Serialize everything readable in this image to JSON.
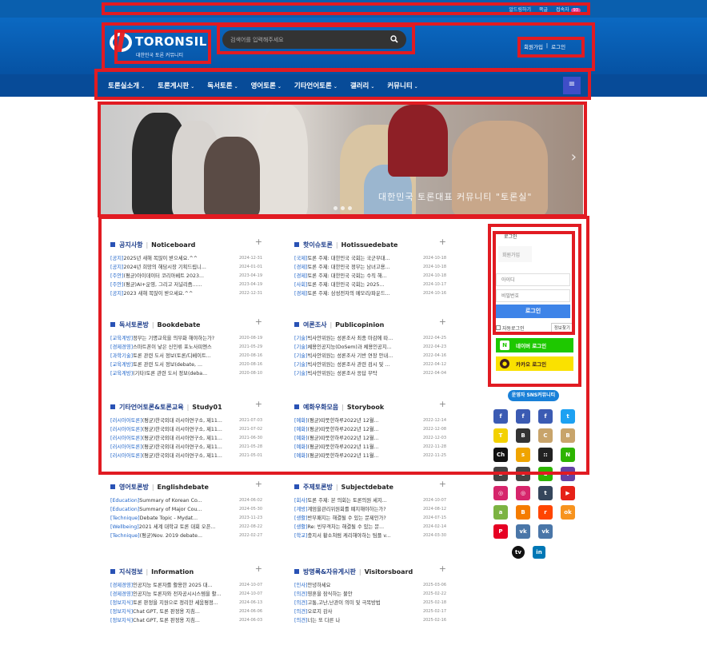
{
  "topbar": {
    "links": [
      "알드링하기",
      "쪽글",
      "접속자"
    ],
    "badge": "93"
  },
  "header": {
    "logo_name": "TORONSIL",
    "logo_sub": "대한민국 토론 커뮤니티",
    "search_placeholder": "검색어를 입력해주세요",
    "join": "회원가입",
    "sep": "|",
    "login": "로그인"
  },
  "nav": {
    "items": [
      "토론실소개",
      "토론게시판",
      "독서토론",
      "영어토론",
      "기타언어토론",
      "갤러리",
      "커뮤니티"
    ],
    "menu_icon": "hamburger-icon"
  },
  "banner": {
    "caption": "대한민국 토론대표 커뮤니티 \"토론실\""
  },
  "boards": [
    {
      "ko": "공지사항",
      "en": "Noticeboard",
      "rows": [
        {
          "cat": "[공지]",
          "t": "2025년 새해 복많이 받으세요.^^",
          "d": "2024-12-31"
        },
        {
          "cat": "[공지]",
          "t": "2024년 희망의 해담시장 기획드립니...",
          "d": "2024-01-01"
        },
        {
          "cat": "[주안]",
          "t": "(평균)아이데이터 코리아베트 2023...",
          "d": "2023-04-19"
        },
        {
          "cat": "[주안]",
          "t": "(평균)AI+운영, 그리고 저널리즘......",
          "d": "2023-04-19"
        },
        {
          "cat": "[공지]",
          "t": "2023 새해 복많이 받으세요.^^",
          "d": "2022-12-31"
        }
      ]
    },
    {
      "ko": "핫이슈토론",
      "en": "Hotissuedebate",
      "rows": [
        {
          "cat": "[국제]",
          "t": "토론 주제: 대한민국 국회는 국군부대...",
          "d": "2024-10-18"
        },
        {
          "cat": "[경제]",
          "t": "토론 주제: 대한민국 정부는 남녀고용...",
          "d": "2024-10-18"
        },
        {
          "cat": "[경제]",
          "t": "토론 주제: 대한민국 국회는 수직 해...",
          "d": "2024-10-18"
        },
        {
          "cat": "[사회]",
          "t": "토론 주제: 대한민국 국회는 2025...",
          "d": "2024-10-17"
        },
        {
          "cat": "[경제]",
          "t": "토론 주제: 삼성전자의 메모리/파운드...",
          "d": "2024-10-16"
        }
      ]
    },
    {
      "ko": "독서토론방",
      "en": "Bookdebate",
      "rows": [
        {
          "cat": "[교육계방]",
          "t": "정부는 기명교육을 의무화 해야하는가?",
          "d": "2020-08-19"
        },
        {
          "cat": "[경제경영]",
          "t": "스마트폰이 낳은 신인류 포노사피엔스",
          "d": "2021-05-29"
        },
        {
          "cat": "[과학기술]",
          "t": "토론 관련 도서 정보(토론/디베이트...",
          "d": "2020-08-16"
        },
        {
          "cat": "[교육계방]",
          "t": "토론 관련 도서 정보(debate, ...",
          "d": "2020-08-16"
        },
        {
          "cat": "[교육계방]",
          "t": "(기타)토론 관련 도서 정보(deba...",
          "d": "2020-08-10"
        }
      ]
    },
    {
      "ko": "여론조사",
      "en": "Publicopinion",
      "rows": [
        {
          "cat": "[기술]",
          "t": "빅사안위원는 성론조사 최종 마감에 따...",
          "d": "2022-04-25"
        },
        {
          "cat": "[기술]",
          "t": "체용인공지능(DoSem)과 체용인공지...",
          "d": "2022-04-23"
        },
        {
          "cat": "[기술]",
          "t": "빅사안위원는 성론조사 기반 연장 안내...",
          "d": "2022-04-16"
        },
        {
          "cat": "[기술]",
          "t": "빅사안위원는 성론조사 관련 검시 및 ...",
          "d": "2022-04-12"
        },
        {
          "cat": "[기술]",
          "t": "빅사안위원는 성론조사 응답 부탁",
          "d": "2022-04-04"
        }
      ]
    },
    {
      "ko": "기타언어토론&토론교육",
      "en": "Study01",
      "rows": [
        {
          "cat": "[러시아어토론]",
          "t": "(평균)한국외대 러시아연구소, 제11...",
          "d": "2021-07-03"
        },
        {
          "cat": "[러시아어토론]",
          "t": "(평균)한국외대 러시아연구소, 제11...",
          "d": "2021-07-02"
        },
        {
          "cat": "[러시아어토론]",
          "t": "(평균)한국외대 러시아연구소, 제11...",
          "d": "2021-06-30"
        },
        {
          "cat": "[러시아어토론]",
          "t": "(평균)한국외대 러시아연구소, 제11...",
          "d": "2021-05-28"
        },
        {
          "cat": "[러시아어토론]",
          "t": "(평균)한국외대 러시아연구소, 제11...",
          "d": "2021-05-01"
        }
      ]
    },
    {
      "ko": "예화우화모음",
      "en": "Storybook",
      "rows": [
        {
          "cat": "[예화]",
          "t": "(평균)따뜻한하루2022년 12월...",
          "d": "2022-12-14"
        },
        {
          "cat": "[예화]",
          "t": "(평균)따뜻한하루2022년 12월...",
          "d": "2022-12-08"
        },
        {
          "cat": "[예화]",
          "t": "(평균)따뜻한하루2022년 12월...",
          "d": "2022-12-03"
        },
        {
          "cat": "[예화]",
          "t": "(평균)따뜻한하루2022년 11월...",
          "d": "2022-11-28"
        },
        {
          "cat": "[예화]",
          "t": "(평균)따뜻한하루2022년 11월...",
          "d": "2022-11-25"
        }
      ]
    },
    {
      "ko": "영어토론방",
      "en": "Englishdebate",
      "rows": [
        {
          "cat": "[Education]",
          "t": "Summary of Korean Co...",
          "d": "2024-06-02"
        },
        {
          "cat": "[Education]",
          "t": "Summary of Major Cou...",
          "d": "2024-05-30"
        },
        {
          "cat": "[Technique]",
          "t": "Debate Topic - Mydat...",
          "d": "2023-11-23"
        },
        {
          "cat": "[Wellbeing]",
          "t": "2021 세계 대학교 토론 대회 오픈...",
          "d": "2022-08-22"
        },
        {
          "cat": "[Technique]",
          "t": "(평균)Nov. 2019 debate...",
          "d": "2022-02-27"
        }
      ]
    },
    {
      "ko": "주제토론방",
      "en": "Subjectdebate",
      "rows": [
        {
          "cat": "[회사]",
          "t": "토론 주제: 본 의회는 토론의원 세지...",
          "d": "2024-10-07"
        },
        {
          "cat": "[계방]",
          "t": "계엄을관리위원회를 폐지해야하는가?",
          "d": "2024-08-12"
        },
        {
          "cat": "[생활]",
          "t": "반부패지는 해결될 수 있는 문제인가?",
          "d": "2024-07-15"
        },
        {
          "cat": "[생활]",
          "t": "Re: 빈부격차는 해결될 수 있는 문...",
          "d": "2024-02-14"
        },
        {
          "cat": "[학교]",
          "t": "충지서 황소쳐럼 케리해야하는 팀플 v...",
          "d": "2024-03-30"
        }
      ]
    },
    {
      "ko": "지식정보",
      "en": "Information",
      "rows": [
        {
          "cat": "[경제경영]",
          "t": "인공지능 토론자를 활용한 2025 대...",
          "d": "2024-10-07"
        },
        {
          "cat": "[경제경영]",
          "t": "인공지능 토론자와 전자공시시스템을 활...",
          "d": "2024-10-07"
        },
        {
          "cat": "[정보지식]",
          "t": "토론 판정을 지원으로 정리한 세움평정...",
          "d": "2024-06-13"
        },
        {
          "cat": "[정보지식]",
          "t": "Chat GPT, 토론 판정용 지침...",
          "d": "2024-06-06"
        },
        {
          "cat": "[정보지식]",
          "t": "Chat GPT, 토론 판정용 지침...",
          "d": "2024-06-03"
        }
      ]
    },
    {
      "ko": "방명록&자유게시판",
      "en": "Visitorsboard",
      "rows": [
        {
          "cat": "[인사]",
          "t": "안녕하세요",
          "d": "2025-03-06"
        },
        {
          "cat": "[의견]",
          "t": "영혼을 잠식하는 불안",
          "d": "2025-02-22"
        },
        {
          "cat": "[의견]",
          "t": "고통,고난,난관이 의미 및 극복방법",
          "d": "2025-02-18"
        },
        {
          "cat": "[의견]",
          "t": "오로지 감사",
          "d": "2025-02-17"
        },
        {
          "cat": "[의견]",
          "t": "너는 또 다른 나",
          "d": "2025-02-16"
        }
      ]
    }
  ],
  "login_box": {
    "title": "로그인",
    "join": "회원가입",
    "id_placeholder": "아이디",
    "pw_placeholder": "비밀번호",
    "login_btn": "로그인",
    "auto": "자동로그인",
    "find": "정보찾기",
    "naver": "네이버 로그인",
    "kakao": "카카오 로그인"
  },
  "sns_title": "운영자 SNS커뮤니티",
  "sns_icons": [
    {
      "name": "facebook-icon",
      "label": "f",
      "color": "#3b5bb3"
    },
    {
      "name": "facebook-icon",
      "label": "f",
      "color": "#3b5bb3"
    },
    {
      "name": "facebook-icon",
      "label": "f",
      "color": "#3b5bb3"
    },
    {
      "name": "twitter-icon",
      "label": "t",
      "color": "#1da1f2"
    },
    {
      "name": "kakaotalk-icon",
      "label": "T",
      "color": "#f3d100"
    },
    {
      "name": "band-icon",
      "label": "B",
      "color": "#333333"
    },
    {
      "name": "cafe-icon",
      "label": "C",
      "color": "#c8a46b"
    },
    {
      "name": "blog-icon",
      "label": "B",
      "color": "#c8a46b"
    },
    {
      "name": "channel-icon",
      "label": "Ch",
      "color": "#111111"
    },
    {
      "name": "kakaostory-icon",
      "label": "s",
      "color": "#f0a400"
    },
    {
      "name": "dice-icon",
      "label": "::",
      "color": "#222222"
    },
    {
      "name": "naver-icon",
      "label": "N",
      "color": "#2db400"
    },
    {
      "name": "blog-icon",
      "label": "B",
      "color": "#444444"
    },
    {
      "name": "cafe-icon",
      "label": "C",
      "color": "#444444"
    },
    {
      "name": "line-icon",
      "label": "L",
      "color": "#2db400"
    },
    {
      "name": "twitch-icon",
      "label": "T",
      "color": "#6441a4"
    },
    {
      "name": "instagram-icon",
      "label": "◎",
      "color": "#d6256b"
    },
    {
      "name": "instagram-icon",
      "label": "◎",
      "color": "#d6256b"
    },
    {
      "name": "tumblr-icon",
      "label": "t",
      "color": "#35465c"
    },
    {
      "name": "youtube-icon",
      "label": "▶",
      "color": "#e62117"
    },
    {
      "name": "android-icon",
      "label": "a",
      "color": "#7cb342"
    },
    {
      "name": "blogger-icon",
      "label": "B",
      "color": "#f57c00"
    },
    {
      "name": "reddit-icon",
      "label": "r",
      "color": "#ff4500"
    },
    {
      "name": "odnoklassniki-icon",
      "label": "ok",
      "color": "#f7931e"
    },
    {
      "name": "pinterest-icon",
      "label": "P",
      "color": "#e60023"
    },
    {
      "name": "vk-icon",
      "label": "vk",
      "color": "#4a76a8"
    },
    {
      "name": "vk-icon",
      "label": "vk",
      "color": "#4a76a8"
    }
  ],
  "sns_icons2": [
    {
      "name": "tv-icon",
      "label": "tv",
      "color": "#111111"
    },
    {
      "name": "linkedin-icon",
      "label": "in",
      "color": "#0077b5"
    }
  ]
}
